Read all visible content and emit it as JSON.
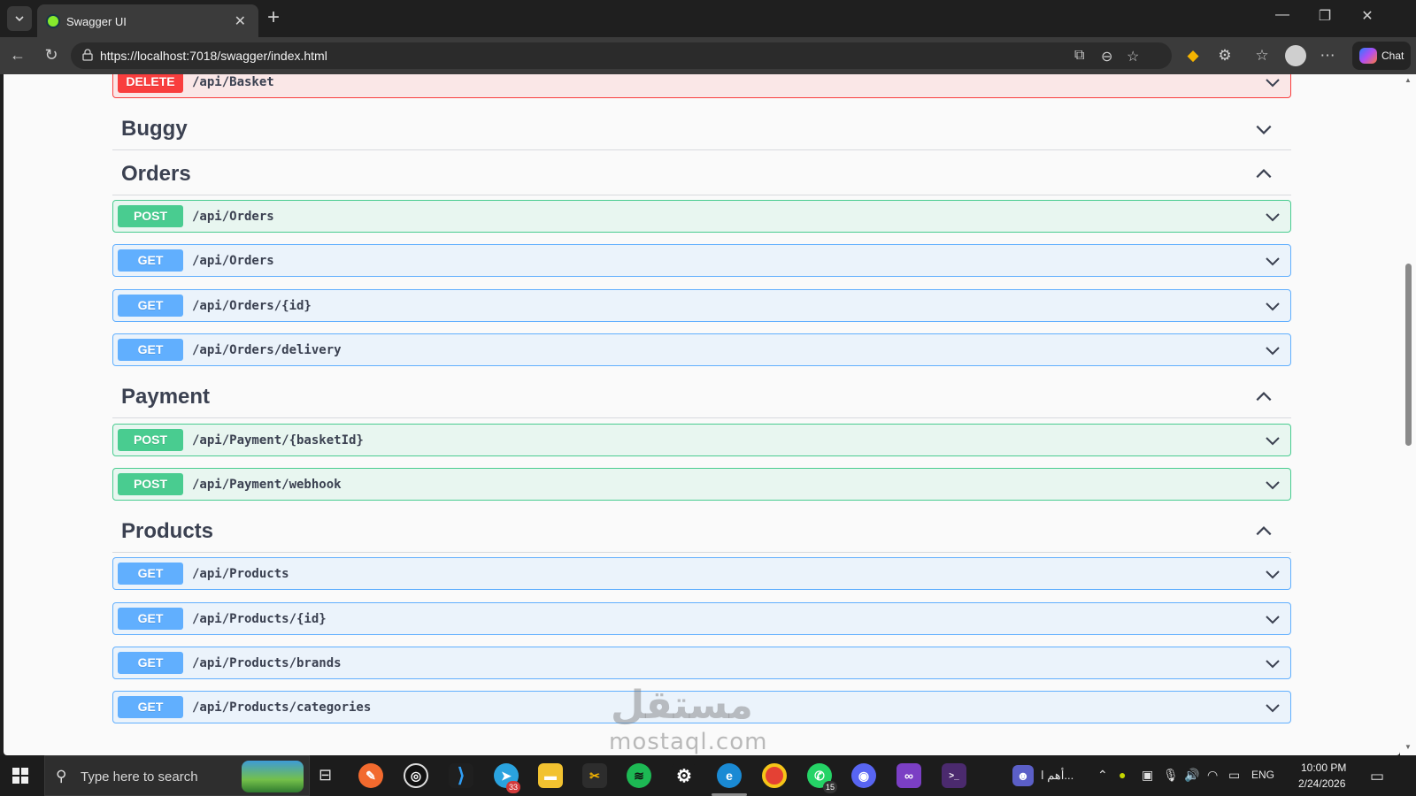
{
  "browser": {
    "tab_title": "Swagger UI",
    "url": "https://localhost:7018/swagger/index.html",
    "chat_label": "Chat"
  },
  "swagger": {
    "partial_operation": {
      "method": "DELETE",
      "path": "/api/Basket"
    },
    "tags": [
      {
        "name": "Buggy",
        "expanded": false,
        "operations": []
      },
      {
        "name": "Orders",
        "expanded": true,
        "operations": [
          {
            "method": "POST",
            "path": "/api/Orders"
          },
          {
            "method": "GET",
            "path": "/api/Orders"
          },
          {
            "method": "GET",
            "path": "/api/Orders/{id}"
          },
          {
            "method": "GET",
            "path": "/api/Orders/delivery"
          }
        ]
      },
      {
        "name": "Payment",
        "expanded": true,
        "operations": [
          {
            "method": "POST",
            "path": "/api/Payment/{basketId}"
          },
          {
            "method": "POST",
            "path": "/api/Payment/webhook"
          }
        ]
      },
      {
        "name": "Products",
        "expanded": true,
        "operations": [
          {
            "method": "GET",
            "path": "/api/Products"
          },
          {
            "method": "GET",
            "path": "/api/Products/{id}"
          },
          {
            "method": "GET",
            "path": "/api/Products/brands"
          },
          {
            "method": "GET",
            "path": "/api/Products/categories"
          }
        ]
      }
    ],
    "colors": {
      "get": "#61affe",
      "post": "#49cc90",
      "delete": "#f93e3e"
    }
  },
  "watermark": {
    "arabic": "مستقل",
    "latin": "mostaql.com"
  },
  "taskbar": {
    "search_placeholder": "Type here to search",
    "telegram_badge": "33",
    "whatsapp_badge": "15",
    "news_text": "أهم ا...",
    "language": "ENG",
    "time": "10:00 PM",
    "date": "2/24/2026"
  }
}
